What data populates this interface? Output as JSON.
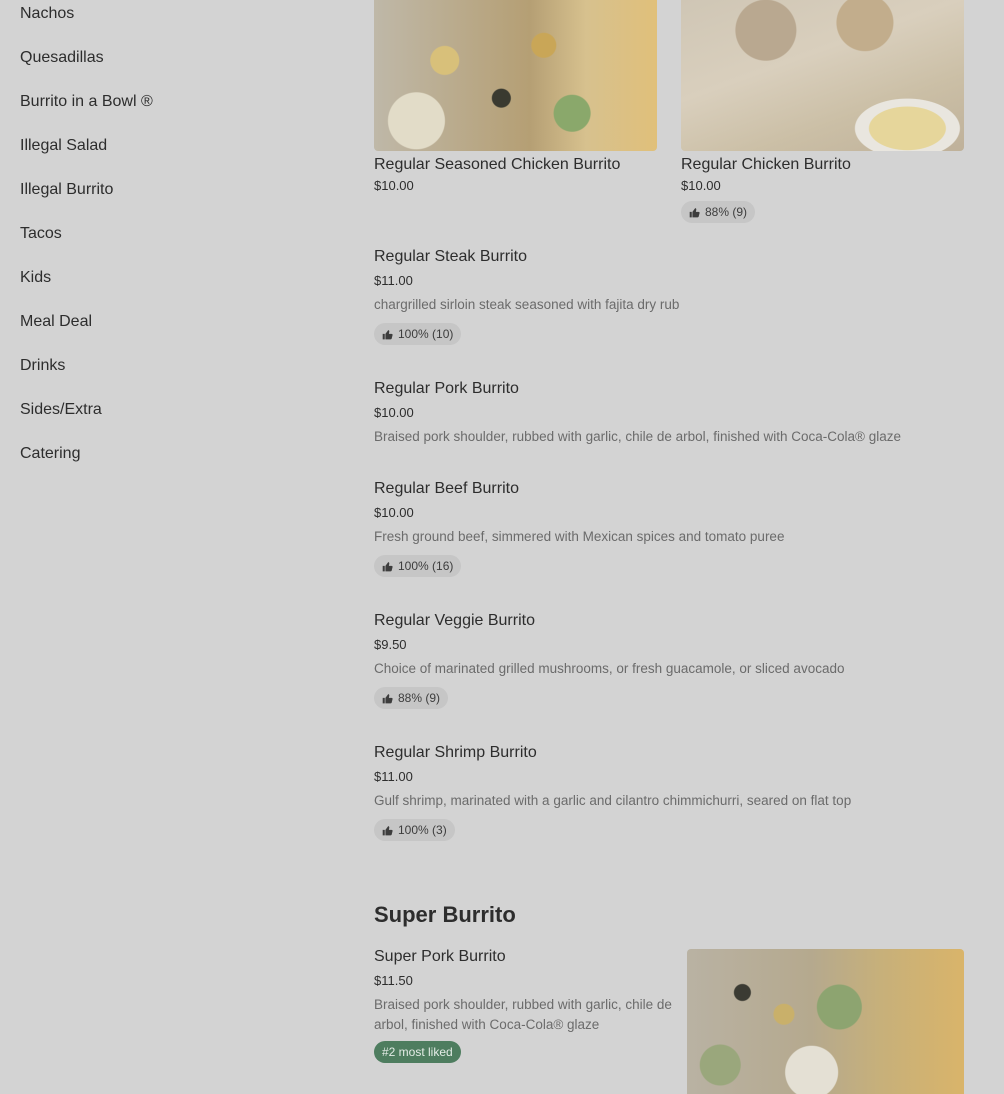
{
  "sidebar": {
    "items": [
      {
        "label": "Nachos"
      },
      {
        "label": "Quesadillas"
      },
      {
        "label": "Burrito in a Bowl ®"
      },
      {
        "label": "Illegal Salad"
      },
      {
        "label": "Illegal Burrito"
      },
      {
        "label": "Tacos"
      },
      {
        "label": "Kids"
      },
      {
        "label": "Meal Deal"
      },
      {
        "label": "Drinks"
      },
      {
        "label": "Sides/Extra"
      },
      {
        "label": "Catering"
      }
    ]
  },
  "cards": [
    {
      "name": "Regular Seasoned Chicken Burrito",
      "price": "$10.00"
    },
    {
      "name": "Regular Chicken Burrito",
      "price": "$10.00",
      "rating": "88% (9)"
    }
  ],
  "items": [
    {
      "name": "Regular Steak Burrito",
      "price": "$11.00",
      "desc": "chargrilled sirloin steak seasoned with fajita dry rub",
      "rating": "100% (10)"
    },
    {
      "name": "Regular Pork Burrito",
      "price": "$10.00",
      "desc": "Braised pork shoulder, rubbed with garlic, chile de arbol, finished with Coca-Cola® glaze"
    },
    {
      "name": "Regular Beef Burrito",
      "price": "$10.00",
      "desc": "Fresh ground beef, simmered with Mexican spices and tomato puree",
      "rating": "100% (16)"
    },
    {
      "name": "Regular Veggie Burrito",
      "price": "$9.50",
      "desc": "Choice of marinated grilled mushrooms, or fresh guacamole, or sliced avocado",
      "rating": "88% (9)"
    },
    {
      "name": "Regular Shrimp Burrito",
      "price": "$11.00",
      "desc": "Gulf shrimp, marinated with a garlic and cilantro chimmichurri, seared on flat top",
      "rating": "100% (3)"
    }
  ],
  "super_section": {
    "title": "Super Burrito",
    "item": {
      "name": "Super Pork Burrito",
      "price": "$11.50",
      "desc": "Braised pork shoulder, rubbed with garlic, chile de arbol, finished with Coca-Cola® glaze",
      "badge": "#2 most liked"
    }
  },
  "colors": {
    "overlay_bg": "#d3d3d3",
    "text": "#2d2d2d",
    "muted": "#6b6b6b",
    "badge_bg": "#c6c6c6",
    "most_liked_bg": "#4e7d5f"
  },
  "icons": {
    "rating": "thumbs-up-icon"
  }
}
